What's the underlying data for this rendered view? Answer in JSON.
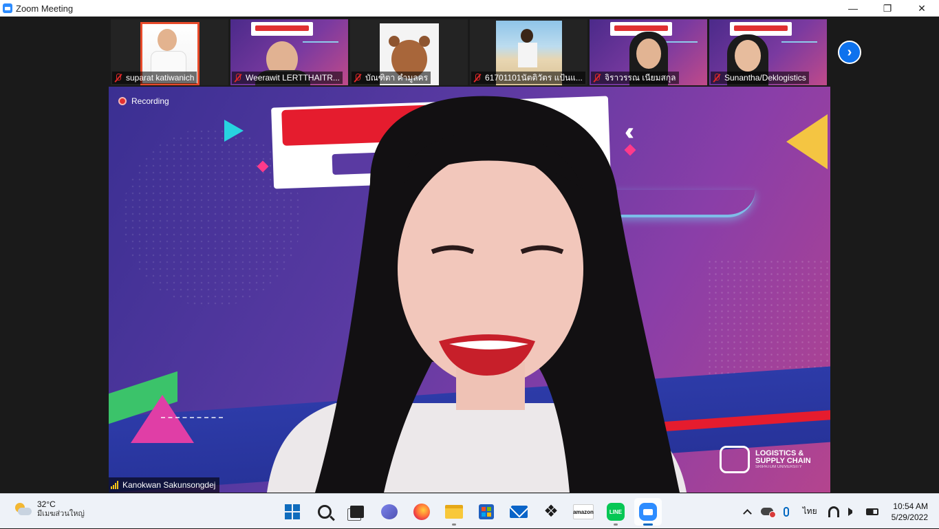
{
  "window": {
    "title": "Zoom Meeting",
    "minimize": "—",
    "restore": "❐",
    "close": "✕"
  },
  "participants": [
    {
      "name": "suparat katiwanich",
      "muted": true
    },
    {
      "name": "Weerawit LERTTHAITR...",
      "muted": true
    },
    {
      "name": "บัณฑิตา คำมูลคร",
      "muted": true
    },
    {
      "name": "61701101นัตติวัตร แป้นแ...",
      "muted": true
    },
    {
      "name": "จิราวรรณ เนียมสกุล",
      "muted": true
    },
    {
      "name": "Sunantha/Deklogistics",
      "muted": true
    }
  ],
  "next_page_glyph": "›",
  "recording": {
    "label": "Recording"
  },
  "speaker": {
    "name": "Kanokwan Sakunsongdej"
  },
  "poster": {
    "logo_line1": "LOGISTICS &",
    "logo_line2": "SUPPLY CHAIN",
    "logo_sub": "SRIPATUM UNIVERSITY"
  },
  "taskbar": {
    "weather_temp": "32°C",
    "weather_desc": "มีเมฆส่วนใหญ่",
    "amazon_label": "amazon",
    "line_label": "LINE",
    "dropbox_glyph": "❖",
    "lang": "ไทย",
    "time": "10:54 AM",
    "date": "5/29/2022"
  },
  "colors": {
    "zoom_blue": "#2d8cff",
    "next_button": "#0e72ed",
    "recording_red": "#e3302f",
    "muted_red": "#e02828"
  },
  "icons": {
    "taskbar": [
      "windows-start-icon",
      "search-icon",
      "task-view-icon",
      "chat-icon",
      "firefox-icon",
      "file-explorer-icon",
      "microsoft-store-icon",
      "mail-icon",
      "dropbox-icon",
      "amazon-icon",
      "line-icon",
      "zoom-icon"
    ],
    "tray": [
      "chevron-up-icon",
      "onedrive-error-icon",
      "microphone-icon",
      "wifi-icon",
      "speaker-icon",
      "battery-icon"
    ]
  }
}
